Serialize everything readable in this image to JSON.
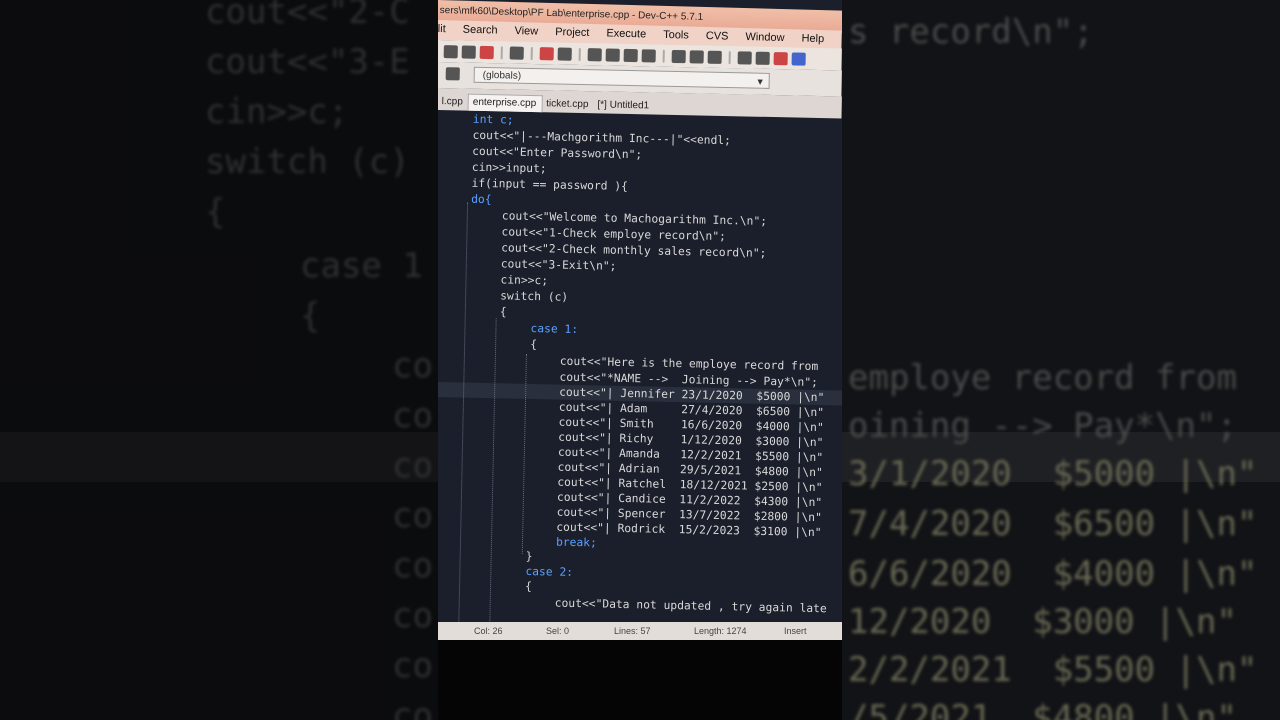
{
  "window": {
    "title": "sers\\mfk60\\Desktop\\PF Lab\\enterprise.cpp - Dev-C++ 5.7.1"
  },
  "menu": [
    "lit",
    "Search",
    "View",
    "Project",
    "Execute",
    "Tools",
    "CVS",
    "Window",
    "Help"
  ],
  "toolbar": {
    "scope_value": "(globals)"
  },
  "tabs": [
    {
      "label": "l.cpp",
      "active": false
    },
    {
      "label": "enterprise.cpp",
      "active": true
    },
    {
      "label": "ticket.cpp",
      "active": false
    },
    {
      "label": "[*] Untitled1",
      "active": false
    }
  ],
  "code": {
    "l01": "int c;",
    "l02": "cout<<\"|---Machgorithm Inc---|\"<<endl;",
    "l03": "cout<<\"Enter Password\\n\";",
    "l04": "cin>>input;",
    "l05": "if(input == password ){",
    "l06": "do{",
    "l07": "cout<<\"Welcome to Machogarithm Inc.\\n\";",
    "l08": "cout<<\"1-Check employe record\\n\";",
    "l09": "cout<<\"2-Check monthly sales record\\n\";",
    "l10": "cout<<\"3-Exit\\n\";",
    "l11": "cin>>c;",
    "l12": "switch (c)",
    "l13": "{",
    "l14": "case 1:",
    "l15": "{",
    "l16": "cout<<\"Here is the employe record from",
    "l17": "cout<<\"*NAME -->  Joining --> Pay*\\n\";",
    "l18": "cout<<\"| Jennifer 23/1/2020  $5000 |\\n\"",
    "l19": "cout<<\"| Adam     27/4/2020  $6500 |\\n\"",
    "l20": "cout<<\"| Smith    16/6/2020  $4000 |\\n\"",
    "l21": "cout<<\"| Richy    1/12/2020  $3000 |\\n\"",
    "l22": "cout<<\"| Amanda   12/2/2021  $5500 |\\n\"",
    "l23": "cout<<\"| Adrian   29/5/2021  $4800 |\\n\"",
    "l24": "cout<<\"| Ratchel  18/12/2021 $2500 |\\n\"",
    "l25": "cout<<\"| Candice  11/2/2022  $4300 |\\n\"",
    "l26": "cout<<\"| Spencer  13/7/2022  $2800 |\\n\"",
    "l27": "cout<<\"| Rodrick  15/2/2023  $3100 |\\n\"",
    "l28": "break;",
    "l29": "}",
    "l30": "case 2:",
    "l31": "{",
    "l32": "cout<<\"Data not updated , try again late"
  },
  "status": {
    "col": "Col:   26",
    "sel": "Sel:   0",
    "lines": "Lines:   57",
    "length": "Length:  1274",
    "mode": "Insert"
  },
  "background_text": {
    "b1": "cout<<\"2-C",
    "b2": "cout<<\"3-E",
    "b3": "cin>>c;",
    "b4": "switch (c)",
    "b5": "{",
    "b6": "case 1",
    "b7": "{",
    "r1": "s record\\n\";",
    "r2": "employe record from",
    "r3": "oining --> Pay*\\n\";",
    "r4": "3/1/2020  $5000 |\\n\"",
    "r5": "7/4/2020  $6500 |\\n\"",
    "r6": "6/6/2020  $4000 |\\n\"",
    "r7": "12/2020  $3000 |\\n\"",
    "r8": "2/2/2021  $5500 |\\n\"",
    "r9": "/5/2021  $4800 |\\n\"",
    "c": "co"
  },
  "colors": {
    "editor_bg": "#1b1f2b",
    "keyword": "#5aa0ff",
    "number": "#ff66cc",
    "titlebar": "#e9a994"
  }
}
